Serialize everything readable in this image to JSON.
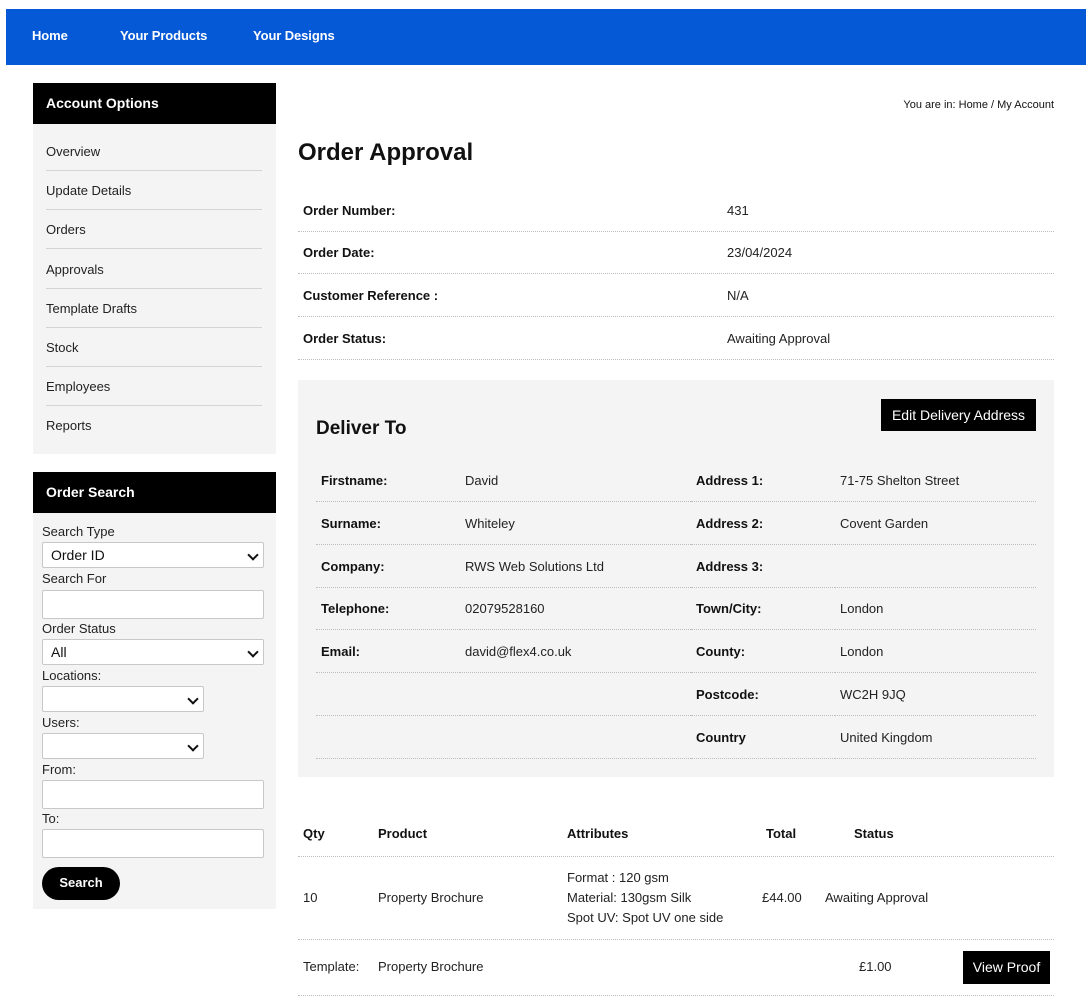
{
  "nav": {
    "items": [
      "Home",
      "Your Products",
      "Your Designs"
    ]
  },
  "account_options": {
    "title": "Account Options",
    "items": [
      "Overview",
      "Update Details",
      "Orders",
      "Approvals",
      "Template Drafts",
      "Stock",
      "Employees",
      "Reports"
    ]
  },
  "order_search": {
    "title": "Order Search",
    "search_type_label": "Search Type",
    "search_type_value": "Order ID",
    "search_for_label": "Search For",
    "search_for_value": "",
    "order_status_label": "Order Status",
    "order_status_value": "All",
    "locations_label": "Locations:",
    "locations_value": "",
    "users_label": "Users:",
    "users_value": "",
    "from_label": "From:",
    "from_value": "",
    "to_label": "To:",
    "to_value": "",
    "search_button": "Search"
  },
  "breadcrumb": {
    "prefix": "You are in: ",
    "home": "Home",
    "sep": " / ",
    "current": "My Account"
  },
  "page_title": "Order Approval",
  "order_info": [
    {
      "label": "Order Number:",
      "value": "431"
    },
    {
      "label": "Order Date:",
      "value": "23/04/2024"
    },
    {
      "label": "Customer Reference :",
      "value": "N/A"
    },
    {
      "label": "Order Status:",
      "value": "Awaiting Approval"
    }
  ],
  "deliver_to": {
    "title": "Deliver To",
    "edit_button": "Edit Delivery Address",
    "left": [
      {
        "label": "Firstname:",
        "value": "David"
      },
      {
        "label": "Surname:",
        "value": "Whiteley"
      },
      {
        "label": "Company:",
        "value": "RWS Web Solutions Ltd"
      },
      {
        "label": "Telephone:",
        "value": "02079528160"
      },
      {
        "label": "Email:",
        "value": "david@flex4.co.uk"
      },
      {
        "label": "",
        "value": ""
      },
      {
        "label": "",
        "value": ""
      }
    ],
    "right": [
      {
        "label": "Address 1:",
        "value": "71-75 Shelton Street"
      },
      {
        "label": "Address 2:",
        "value": "Covent Garden"
      },
      {
        "label": "Address 3:",
        "value": ""
      },
      {
        "label": "Town/City:",
        "value": "London"
      },
      {
        "label": "County:",
        "value": "London"
      },
      {
        "label": "Postcode:",
        "value": "WC2H 9JQ"
      },
      {
        "label": "Country",
        "value": "United Kingdom"
      }
    ]
  },
  "products": {
    "headers": {
      "qty": "Qty",
      "product": "Product",
      "attributes": "Attributes",
      "total": "Total",
      "status": "Status"
    },
    "row": {
      "qty": "10",
      "product": "Property Brochure",
      "attributes": [
        "Format : 120 gsm",
        "Material: 130gsm Silk",
        "Spot UV: Spot UV one side"
      ],
      "total": "£44.00",
      "status": "Awaiting Approval"
    },
    "template": {
      "label": "Template:",
      "name": "Property Brochure",
      "price": "£1.00",
      "button": "View Proof"
    }
  }
}
